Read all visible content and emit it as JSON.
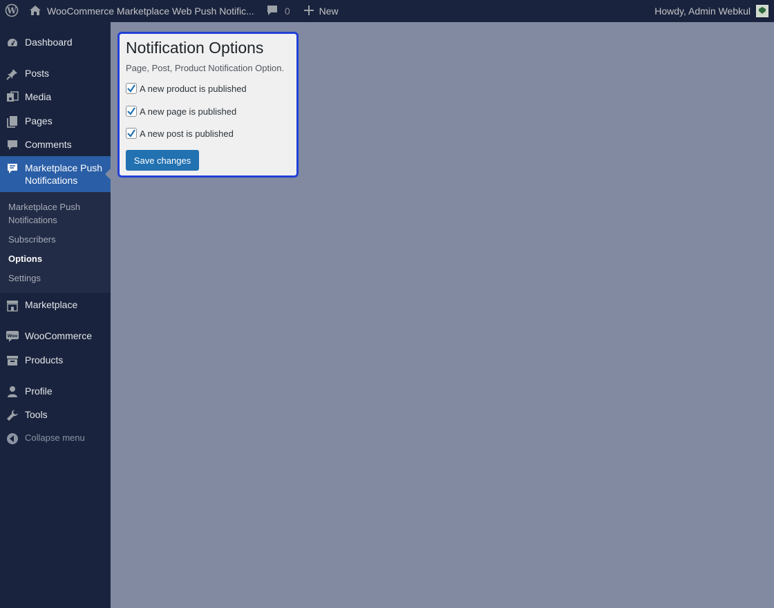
{
  "adminbar": {
    "wp_logo": "wordpress-icon",
    "site_title": "WooCommerce Marketplace Web Push Notific...",
    "comments_count": "0",
    "new_label": "New",
    "howdy": "Howdy, Admin Webkul"
  },
  "sidebar": {
    "items": [
      {
        "label": "Dashboard",
        "icon": "dashboard-icon"
      },
      {
        "label": "Posts",
        "icon": "pin-icon"
      },
      {
        "label": "Media",
        "icon": "media-icon"
      },
      {
        "label": "Pages",
        "icon": "pages-icon"
      },
      {
        "label": "Comments",
        "icon": "comment-icon"
      },
      {
        "label": "Marketplace Push Notifications",
        "icon": "notification-icon"
      },
      {
        "label": "Marketplace",
        "icon": "store-icon"
      },
      {
        "label": "WooCommerce",
        "icon": "woo-icon"
      },
      {
        "label": "Products",
        "icon": "archive-icon"
      },
      {
        "label": "Profile",
        "icon": "user-icon"
      },
      {
        "label": "Tools",
        "icon": "wrench-icon"
      },
      {
        "label": "Collapse menu",
        "icon": "collapse-icon"
      }
    ],
    "submenu": [
      {
        "label": "Marketplace Push Notifications"
      },
      {
        "label": "Subscribers"
      },
      {
        "label": "Options"
      },
      {
        "label": "Settings"
      }
    ]
  },
  "panel": {
    "title": "Notification Options",
    "description": "Page, Post, Product Notification Option.",
    "options": [
      {
        "label": "A new product is published",
        "checked": true
      },
      {
        "label": "A new page is published",
        "checked": true
      },
      {
        "label": "A new post is published",
        "checked": true
      }
    ],
    "save_label": "Save changes"
  },
  "colors": {
    "accent": "#2271b1",
    "sidebar_bg": "#19233d",
    "current_menu": "#2a5ea6",
    "highlight_border": "#2140d6"
  }
}
